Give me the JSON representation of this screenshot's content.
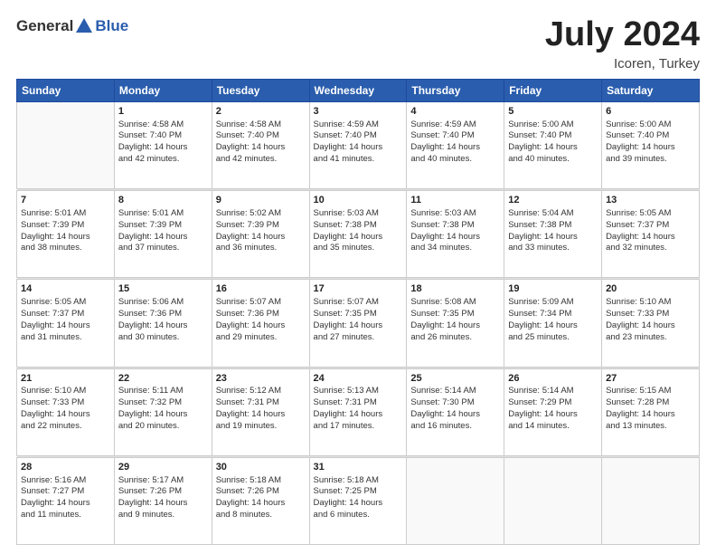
{
  "header": {
    "logo_general": "General",
    "logo_blue": "Blue",
    "month_title": "July 2024",
    "location": "Icoren, Turkey"
  },
  "days_of_week": [
    "Sunday",
    "Monday",
    "Tuesday",
    "Wednesday",
    "Thursday",
    "Friday",
    "Saturday"
  ],
  "weeks": [
    [
      {
        "day": "",
        "lines": []
      },
      {
        "day": "1",
        "lines": [
          "Sunrise: 4:58 AM",
          "Sunset: 7:40 PM",
          "Daylight: 14 hours",
          "and 42 minutes."
        ]
      },
      {
        "day": "2",
        "lines": [
          "Sunrise: 4:58 AM",
          "Sunset: 7:40 PM",
          "Daylight: 14 hours",
          "and 42 minutes."
        ]
      },
      {
        "day": "3",
        "lines": [
          "Sunrise: 4:59 AM",
          "Sunset: 7:40 PM",
          "Daylight: 14 hours",
          "and 41 minutes."
        ]
      },
      {
        "day": "4",
        "lines": [
          "Sunrise: 4:59 AM",
          "Sunset: 7:40 PM",
          "Daylight: 14 hours",
          "and 40 minutes."
        ]
      },
      {
        "day": "5",
        "lines": [
          "Sunrise: 5:00 AM",
          "Sunset: 7:40 PM",
          "Daylight: 14 hours",
          "and 40 minutes."
        ]
      },
      {
        "day": "6",
        "lines": [
          "Sunrise: 5:00 AM",
          "Sunset: 7:40 PM",
          "Daylight: 14 hours",
          "and 39 minutes."
        ]
      }
    ],
    [
      {
        "day": "7",
        "lines": [
          "Sunrise: 5:01 AM",
          "Sunset: 7:39 PM",
          "Daylight: 14 hours",
          "and 38 minutes."
        ]
      },
      {
        "day": "8",
        "lines": [
          "Sunrise: 5:01 AM",
          "Sunset: 7:39 PM",
          "Daylight: 14 hours",
          "and 37 minutes."
        ]
      },
      {
        "day": "9",
        "lines": [
          "Sunrise: 5:02 AM",
          "Sunset: 7:39 PM",
          "Daylight: 14 hours",
          "and 36 minutes."
        ]
      },
      {
        "day": "10",
        "lines": [
          "Sunrise: 5:03 AM",
          "Sunset: 7:38 PM",
          "Daylight: 14 hours",
          "and 35 minutes."
        ]
      },
      {
        "day": "11",
        "lines": [
          "Sunrise: 5:03 AM",
          "Sunset: 7:38 PM",
          "Daylight: 14 hours",
          "and 34 minutes."
        ]
      },
      {
        "day": "12",
        "lines": [
          "Sunrise: 5:04 AM",
          "Sunset: 7:38 PM",
          "Daylight: 14 hours",
          "and 33 minutes."
        ]
      },
      {
        "day": "13",
        "lines": [
          "Sunrise: 5:05 AM",
          "Sunset: 7:37 PM",
          "Daylight: 14 hours",
          "and 32 minutes."
        ]
      }
    ],
    [
      {
        "day": "14",
        "lines": [
          "Sunrise: 5:05 AM",
          "Sunset: 7:37 PM",
          "Daylight: 14 hours",
          "and 31 minutes."
        ]
      },
      {
        "day": "15",
        "lines": [
          "Sunrise: 5:06 AM",
          "Sunset: 7:36 PM",
          "Daylight: 14 hours",
          "and 30 minutes."
        ]
      },
      {
        "day": "16",
        "lines": [
          "Sunrise: 5:07 AM",
          "Sunset: 7:36 PM",
          "Daylight: 14 hours",
          "and 29 minutes."
        ]
      },
      {
        "day": "17",
        "lines": [
          "Sunrise: 5:07 AM",
          "Sunset: 7:35 PM",
          "Daylight: 14 hours",
          "and 27 minutes."
        ]
      },
      {
        "day": "18",
        "lines": [
          "Sunrise: 5:08 AM",
          "Sunset: 7:35 PM",
          "Daylight: 14 hours",
          "and 26 minutes."
        ]
      },
      {
        "day": "19",
        "lines": [
          "Sunrise: 5:09 AM",
          "Sunset: 7:34 PM",
          "Daylight: 14 hours",
          "and 25 minutes."
        ]
      },
      {
        "day": "20",
        "lines": [
          "Sunrise: 5:10 AM",
          "Sunset: 7:33 PM",
          "Daylight: 14 hours",
          "and 23 minutes."
        ]
      }
    ],
    [
      {
        "day": "21",
        "lines": [
          "Sunrise: 5:10 AM",
          "Sunset: 7:33 PM",
          "Daylight: 14 hours",
          "and 22 minutes."
        ]
      },
      {
        "day": "22",
        "lines": [
          "Sunrise: 5:11 AM",
          "Sunset: 7:32 PM",
          "Daylight: 14 hours",
          "and 20 minutes."
        ]
      },
      {
        "day": "23",
        "lines": [
          "Sunrise: 5:12 AM",
          "Sunset: 7:31 PM",
          "Daylight: 14 hours",
          "and 19 minutes."
        ]
      },
      {
        "day": "24",
        "lines": [
          "Sunrise: 5:13 AM",
          "Sunset: 7:31 PM",
          "Daylight: 14 hours",
          "and 17 minutes."
        ]
      },
      {
        "day": "25",
        "lines": [
          "Sunrise: 5:14 AM",
          "Sunset: 7:30 PM",
          "Daylight: 14 hours",
          "and 16 minutes."
        ]
      },
      {
        "day": "26",
        "lines": [
          "Sunrise: 5:14 AM",
          "Sunset: 7:29 PM",
          "Daylight: 14 hours",
          "and 14 minutes."
        ]
      },
      {
        "day": "27",
        "lines": [
          "Sunrise: 5:15 AM",
          "Sunset: 7:28 PM",
          "Daylight: 14 hours",
          "and 13 minutes."
        ]
      }
    ],
    [
      {
        "day": "28",
        "lines": [
          "Sunrise: 5:16 AM",
          "Sunset: 7:27 PM",
          "Daylight: 14 hours",
          "and 11 minutes."
        ]
      },
      {
        "day": "29",
        "lines": [
          "Sunrise: 5:17 AM",
          "Sunset: 7:26 PM",
          "Daylight: 14 hours",
          "and 9 minutes."
        ]
      },
      {
        "day": "30",
        "lines": [
          "Sunrise: 5:18 AM",
          "Sunset: 7:26 PM",
          "Daylight: 14 hours",
          "and 8 minutes."
        ]
      },
      {
        "day": "31",
        "lines": [
          "Sunrise: 5:18 AM",
          "Sunset: 7:25 PM",
          "Daylight: 14 hours",
          "and 6 minutes."
        ]
      },
      {
        "day": "",
        "lines": []
      },
      {
        "day": "",
        "lines": []
      },
      {
        "day": "",
        "lines": []
      }
    ]
  ]
}
